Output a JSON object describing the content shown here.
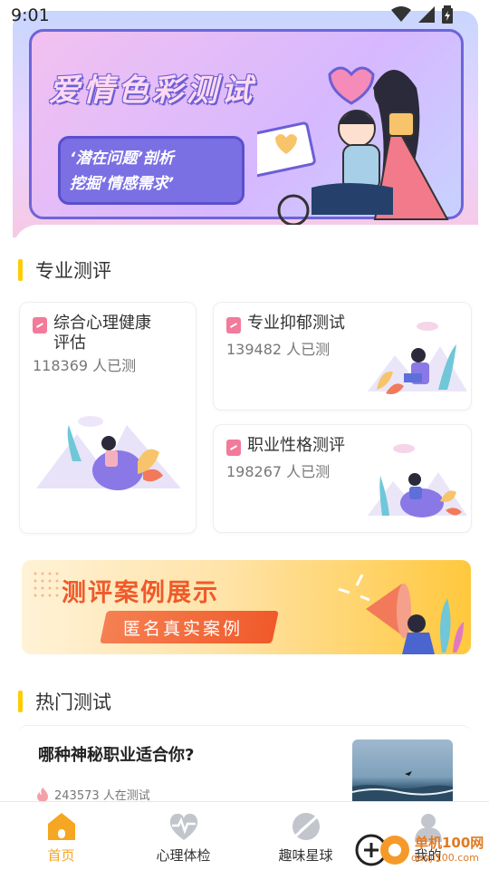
{
  "status": {
    "time": "9:01"
  },
  "banner": {
    "title": "爱情色彩测试",
    "tag_line1": "‘潜在问题’剖析",
    "tag_line2": "挖掘‘情感需求’"
  },
  "sections": {
    "professional": "专业测评",
    "hot": "热门测试"
  },
  "cards": [
    {
      "title_line1": "综合心理健康",
      "title_line2": "评估",
      "count": "118369 人已测"
    },
    {
      "title_line1": "专业抑郁测试",
      "count": "139482 人已测"
    },
    {
      "title_line1": "职业性格测评",
      "count": "198267 人已测"
    }
  ],
  "case_banner": {
    "title": "测评案例展示",
    "subtitle": "匿名真实案例"
  },
  "hot_test": {
    "title": "哪种神秘职业适合你?",
    "count": "243573 人在测试"
  },
  "nav": [
    {
      "label": "首页",
      "icon": "home-icon",
      "active": true
    },
    {
      "label": "心理体检",
      "icon": "heart-pulse-icon",
      "active": false
    },
    {
      "label": "趣味星球",
      "icon": "planet-icon",
      "active": false
    },
    {
      "label": "我的",
      "icon": "user-icon",
      "active": false
    }
  ],
  "watermark": {
    "text": "单机100网",
    "url": "danji100.com"
  },
  "colors": {
    "accent": "#ffcc00",
    "nav_active": "#f5a623",
    "doc_icon": "#f27a9a",
    "case_orange": "#f05a2a"
  }
}
